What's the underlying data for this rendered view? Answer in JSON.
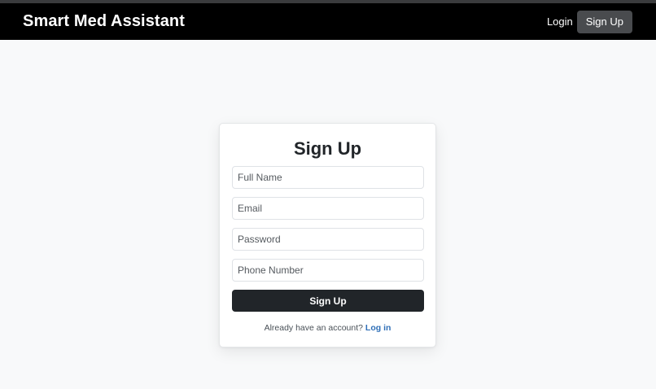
{
  "navbar": {
    "brand": "Smart Med Assistant",
    "login_label": "Login",
    "signup_label": "Sign Up"
  },
  "form": {
    "title": "Sign Up",
    "full_name": {
      "value": "",
      "placeholder": "Full Name"
    },
    "email": {
      "value": "",
      "placeholder": "Email"
    },
    "password": {
      "value": "",
      "placeholder": "Password"
    },
    "phone": {
      "value": "",
      "placeholder": "Phone Number"
    },
    "submit_label": "Sign Up",
    "footer_text": "Already have an account?",
    "login_link": "Log in"
  },
  "colors": {
    "navbar_bg": "#000000",
    "page_bg": "#f8f9fa",
    "primary_button": "#212529",
    "nav_button": "#494b4e",
    "link": "#2f6fb7"
  }
}
